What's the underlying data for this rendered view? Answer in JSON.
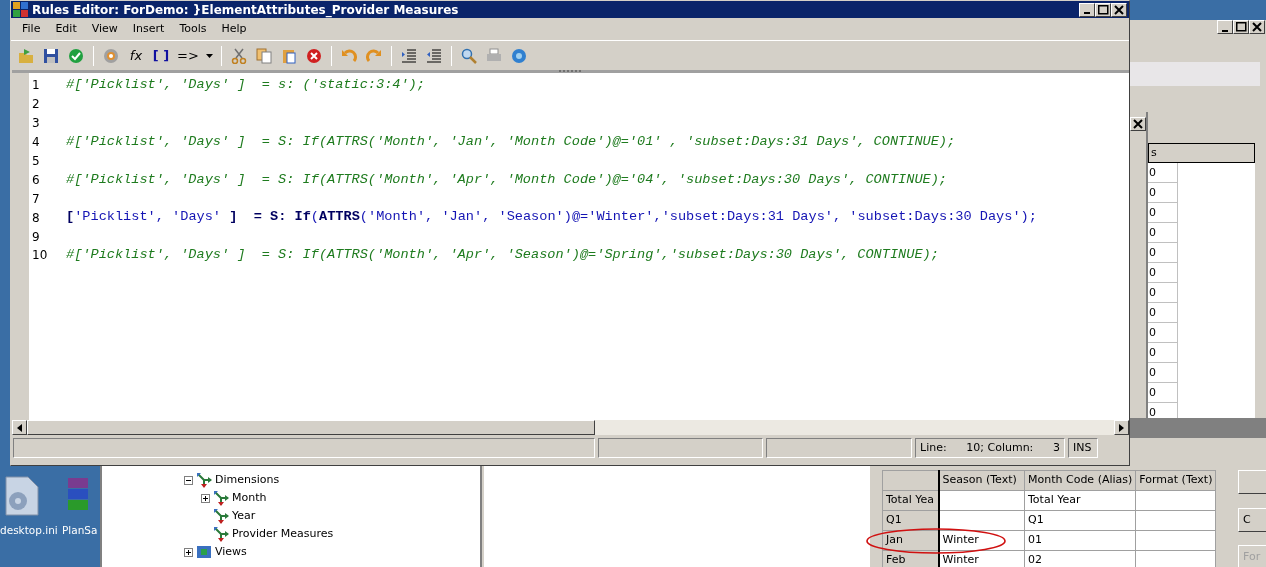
{
  "desktop": {
    "icons": [
      {
        "label": "desktop.ini"
      },
      {
        "label": "PlanSa"
      }
    ]
  },
  "editor": {
    "title": "Rules Editor: ForDemo: }ElementAttributes_Provider Measures",
    "menu": [
      "File",
      "Edit",
      "View",
      "Insert",
      "Tools",
      "Help"
    ],
    "toolbar_texts": [
      "fx",
      "[ ]",
      "=>"
    ],
    "lines": [
      {
        "number": "1",
        "kind": "comment",
        "text": "#['Picklist', 'Days' ]  = s: ('static:3:4');"
      },
      {
        "number": "2",
        "kind": "blank"
      },
      {
        "number": "3",
        "kind": "blank"
      },
      {
        "number": "4",
        "kind": "comment",
        "text": "#['Picklist', 'Days' ]  = S: If(ATTRS('Month', 'Jan', 'Month Code')@='01' , 'subset:Days:31 Days', CONTINUE);"
      },
      {
        "number": "5",
        "kind": "blank"
      },
      {
        "number": "6",
        "kind": "comment",
        "text": "#['Picklist', 'Days' ]  = S: If(ATTRS('Month', 'Apr', 'Month Code')@='04', 'subset:Days:30 Days', CONTINUE);"
      },
      {
        "number": "7",
        "kind": "blank"
      },
      {
        "number": "8",
        "kind": "code",
        "text": "**[**'Picklist', 'Days' **]**  **=** **S:** **If**(**ATTRS**('Month', 'Jan', 'Season')@='Winter','subset:Days:31 Days', 'subset:Days:30 Days');"
      },
      {
        "number": "9",
        "kind": "blank"
      },
      {
        "number": "10",
        "kind": "comment",
        "text": "#['Picklist', 'Days' ]  = S: If(ATTRS('Month', 'Apr', 'Season')@='Spring','subset:Days:30 Days', CONTINUE);"
      }
    ],
    "status_bar": {
      "line_label": "Line:",
      "position": "10; Column:",
      "column": "3",
      "mode": "INS"
    }
  },
  "back_window": {
    "side_table": {
      "header": "s",
      "cells": [
        "0",
        "0",
        "0",
        "0",
        "0",
        "0",
        "0",
        "0",
        "0",
        "0",
        "0",
        "0",
        "0"
      ]
    },
    "tree": [
      {
        "label": "Dimensions",
        "expanded": true,
        "children": [
          {
            "label": "Month",
            "expanded": false
          },
          {
            "label": "Year"
          },
          {
            "label": "Provider Measures"
          }
        ]
      },
      {
        "label": "Views",
        "expanded": false
      }
    ],
    "grid": {
      "columns": [
        "Season (Text)",
        "Month Code (Alias)",
        "Format (Text)"
      ],
      "rows": [
        {
          "header": "Total Yea",
          "cells": [
            null,
            "Total Year",
            null
          ]
        },
        {
          "header": "Q1",
          "cells": [
            null,
            "Q1",
            null
          ]
        },
        {
          "header": "Jan",
          "cells": [
            "Winter",
            "01",
            null
          ]
        },
        {
          "header": "Feb",
          "cells": [
            "Winter",
            "02",
            null
          ]
        }
      ]
    },
    "side_buttons": [
      {
        "label": "C",
        "disabled": false
      },
      {
        "label": "For",
        "disabled": true
      }
    ]
  }
}
